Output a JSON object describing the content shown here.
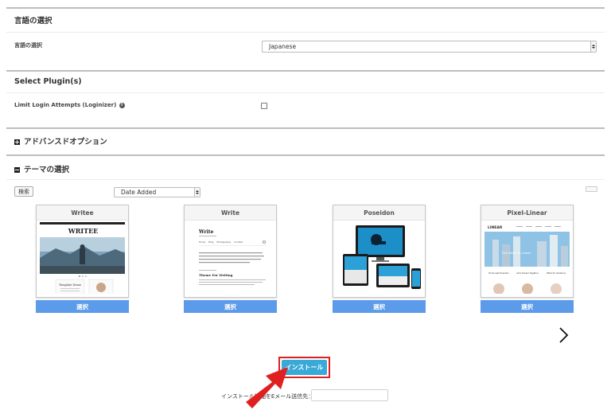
{
  "language_section": {
    "title": "言語の選択",
    "row_label": "言語の選択",
    "select_value": "Japanese"
  },
  "plugin_section": {
    "title": "Select Plugin(s)",
    "row_label": "Limit Login Attempts (Loginizer)",
    "info_glyph": "i",
    "checked": false
  },
  "advanced_section": {
    "title": "アドバンスドオプション",
    "icon": "plus-square-icon"
  },
  "theme_section": {
    "title": "テーマの選択",
    "icon": "minus-square-icon",
    "search_label": "検索",
    "sort_value": "Date Added",
    "themes": [
      {
        "name": "Writee",
        "select_label": "選択"
      },
      {
        "name": "Write",
        "select_label": "選択"
      },
      {
        "name": "Poseidon",
        "select_label": "選択"
      },
      {
        "name": "Pixel-Linear",
        "select_label": "選択"
      }
    ],
    "next_icon": "chevron-right-icon"
  },
  "thumbnails": {
    "writee": {
      "logo": "WRITEE",
      "post_title": "Template Demo"
    },
    "write": {
      "logo": "Write",
      "nav": [
        "Home",
        "Blog",
        "Photography",
        "Contact"
      ],
      "post_title": "Theme For Writing"
    },
    "linear": {
      "logo": "LINEAR",
      "hero_text": "The World Is Linear",
      "features": [
        "Home Get Direction",
        "Let's Dream Together",
        "Write for Solutions"
      ]
    }
  },
  "install": {
    "button_label": "インストール",
    "email_label": "インストール詳細をEメール送信先：:",
    "email_value": ""
  },
  "colors": {
    "select_button": "#5b9bea",
    "install_button": "#39a9d8",
    "highlight": "#e02020"
  }
}
